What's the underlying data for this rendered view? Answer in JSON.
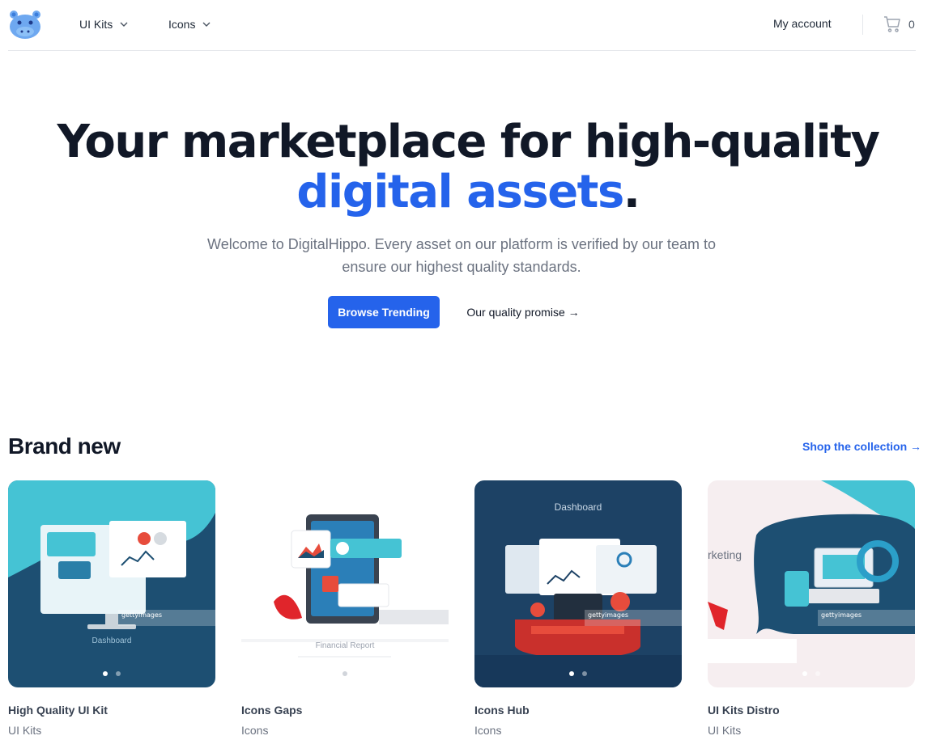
{
  "header": {
    "nav": [
      {
        "label": "UI Kits"
      },
      {
        "label": "Icons"
      }
    ],
    "account_label": "My account",
    "cart_count": "0"
  },
  "hero": {
    "title_part1": "Your marketplace for high-quality ",
    "title_accent": "digital assets",
    "title_end": ".",
    "subtitle": "Welcome to DigitalHippo. Every asset on our platform is verified by our team to ensure our highest quality standards.",
    "primary_button": "Browse Trending",
    "secondary_button": "Our quality promise →"
  },
  "section": {
    "title": "Brand new",
    "link": "Shop the collection →"
  },
  "products": [
    {
      "name": "High Quality UI Kit",
      "category": "UI Kits",
      "thumb_caption": "Dashboard"
    },
    {
      "name": "Icons Gaps",
      "category": "Icons",
      "thumb_caption": "Financial Report"
    },
    {
      "name": "Icons Hub",
      "category": "Icons",
      "thumb_caption": "Dashboard"
    },
    {
      "name": "UI Kits Distro",
      "category": "UI Kits",
      "thumb_caption": "rketing"
    }
  ],
  "watermark": "gettyimages",
  "colors": {
    "accent": "#2563eb",
    "text": "#111827",
    "muted": "#6b7280"
  }
}
